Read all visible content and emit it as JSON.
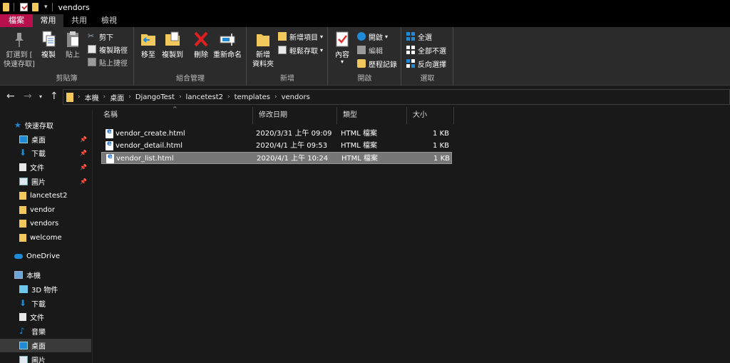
{
  "window": {
    "title": "vendors"
  },
  "tabs": [
    {
      "label": "檔案"
    },
    {
      "label": "常用"
    },
    {
      "label": "共用"
    },
    {
      "label": "檢視"
    }
  ],
  "ribbon": {
    "clipboard": {
      "label": "剪貼簿",
      "pin_label_1": "釘選到 [",
      "pin_label_2": "快速存取]",
      "copy": "複製",
      "paste": "貼上",
      "cut": "剪下",
      "copy_path": "複製路徑",
      "paste_shortcut": "貼上捷徑"
    },
    "organize": {
      "label": "組合管理",
      "move_to": "移至",
      "copy_to": "複製到",
      "delete": "刪除",
      "rename": "重新命名"
    },
    "new": {
      "label": "新增",
      "new_folder_1": "新增",
      "new_folder_2": "資料夾",
      "new_item": "新增項目",
      "easy_access": "輕鬆存取"
    },
    "open": {
      "label": "開啟",
      "properties": "內容",
      "open": "開啟",
      "edit": "編輯",
      "history": "歷程記錄"
    },
    "select": {
      "label": "選取",
      "select_all": "全選",
      "select_none": "全部不選",
      "invert": "反向選擇"
    }
  },
  "address": {
    "crumbs": [
      "本機",
      "桌面",
      "DjangoTest",
      "lancetest2",
      "templates",
      "vendors"
    ]
  },
  "nav": {
    "quick_access": "快速存取",
    "items": [
      {
        "label": "桌面"
      },
      {
        "label": "下載"
      },
      {
        "label": "文件"
      },
      {
        "label": "圖片"
      },
      {
        "label": "lancetest2"
      },
      {
        "label": "vendor"
      },
      {
        "label": "vendors"
      },
      {
        "label": "welcome"
      }
    ],
    "onedrive": "OneDrive",
    "this_pc": "本機",
    "pc_items": [
      {
        "label": "3D 物件"
      },
      {
        "label": "下載"
      },
      {
        "label": "文件"
      },
      {
        "label": "音樂"
      },
      {
        "label": "桌面"
      },
      {
        "label": "圖片"
      }
    ]
  },
  "columns": {
    "name": "名稱",
    "modified": "修改日期",
    "type": "類型",
    "size": "大小"
  },
  "files": [
    {
      "name": "vendor_create.html",
      "modified": "2020/3/31 上午 09:09",
      "type": "HTML 檔案",
      "size": "1 KB"
    },
    {
      "name": "vendor_detail.html",
      "modified": "2020/4/1 上午 09:53",
      "type": "HTML 檔案",
      "size": "1 KB"
    },
    {
      "name": "vendor_list.html",
      "modified": "2020/4/1 上午 10:24",
      "type": "HTML 檔案",
      "size": "1 KB"
    }
  ],
  "colors": {
    "file_tab": "#b8104b",
    "folder": "#f2c75c",
    "accent_blue": "#1f8ad6"
  }
}
